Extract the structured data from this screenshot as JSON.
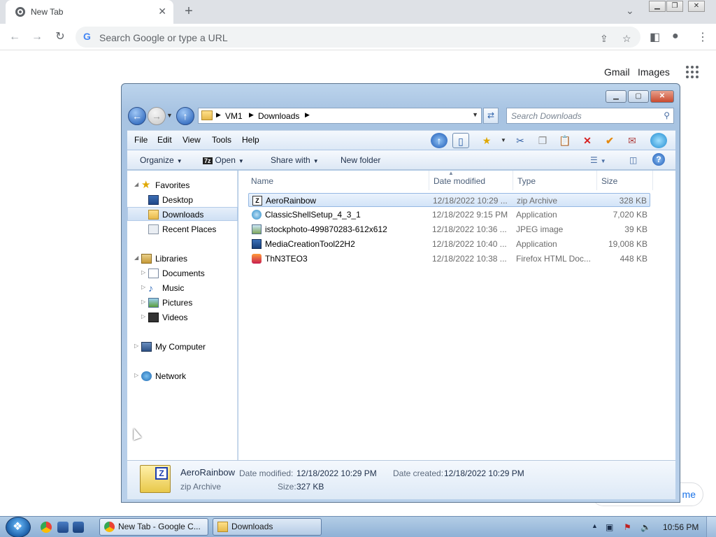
{
  "browser": {
    "tab_title": "New Tab",
    "tab_close": "✕",
    "new_tab": "+",
    "omnibox_placeholder": "Search Google or type a URL",
    "links": {
      "gmail": "Gmail",
      "images": "Images"
    },
    "customize_partial": "me"
  },
  "explorer": {
    "address": {
      "segments": [
        "VM1",
        "Downloads"
      ]
    },
    "search_placeholder": "Search Downloads",
    "menu": [
      "File",
      "Edit",
      "View",
      "Tools",
      "Help"
    ],
    "commands": {
      "organize": "Organize",
      "open": "Open",
      "open_badge": "7z",
      "share": "Share with",
      "new_folder": "New folder"
    },
    "nav": {
      "favorites": "Favorites",
      "desktop": "Desktop",
      "downloads": "Downloads",
      "recent": "Recent Places",
      "libraries": "Libraries",
      "documents": "Documents",
      "music": "Music",
      "pictures": "Pictures",
      "videos": "Videos",
      "computer": "My Computer",
      "network": "Network"
    },
    "columns": {
      "name": "Name",
      "date": "Date modified",
      "type": "Type",
      "size": "Size"
    },
    "files": [
      {
        "name": "AeroRainbow",
        "date": "12/18/2022 10:29 ...",
        "type": "zip Archive",
        "size": "328 KB",
        "icon": "zip-icon",
        "selected": true
      },
      {
        "name": "ClassicShellSetup_4_3_1",
        "date": "12/18/2022 9:15 PM",
        "type": "Application",
        "size": "7,020 KB",
        "icon": "app-icon"
      },
      {
        "name": "istockphoto-499870283-612x612",
        "date": "12/18/2022 10:36 ...",
        "type": "JPEG image",
        "size": "39 KB",
        "icon": "image-icon"
      },
      {
        "name": "MediaCreationTool22H2",
        "date": "12/18/2022 10:40 ...",
        "type": "Application",
        "size": "19,008 KB",
        "icon": "app-icon"
      },
      {
        "name": "ThN3TEO3",
        "date": "12/18/2022 10:38 ...",
        "type": "Firefox HTML Doc...",
        "size": "448 KB",
        "icon": "html-icon"
      }
    ],
    "details": {
      "name": "AeroRainbow",
      "type": "zip Archive",
      "modified_label": "Date modified:",
      "modified_value": "12/18/2022 10:29 PM",
      "created_label": "Date created:",
      "created_value": "12/18/2022 10:29 PM",
      "size_label": "Size:",
      "size_value": "327 KB"
    }
  },
  "taskbar": {
    "chrome_task": "New Tab - Google C...",
    "downloads_task": "Downloads",
    "clock": "10:56 PM"
  }
}
